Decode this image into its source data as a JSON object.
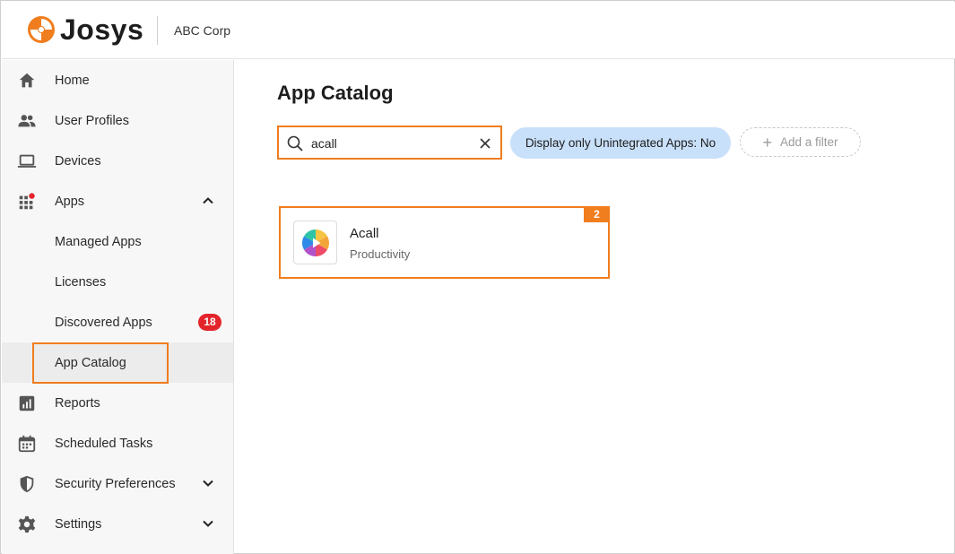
{
  "header": {
    "brand": "Josys",
    "org": "ABC Corp"
  },
  "sidebar": {
    "items": [
      {
        "label": "Home",
        "icon": "home-icon"
      },
      {
        "label": "User Profiles",
        "icon": "users-icon"
      },
      {
        "label": "Devices",
        "icon": "laptop-icon"
      },
      {
        "label": "Apps",
        "icon": "apps-grid-icon",
        "expanded": true
      },
      {
        "label": "Managed Apps"
      },
      {
        "label": "Licenses"
      },
      {
        "label": "Discovered Apps",
        "badge": "18"
      },
      {
        "label": "App Catalog",
        "active": true
      },
      {
        "label": "Reports",
        "icon": "reports-icon"
      },
      {
        "label": "Scheduled Tasks",
        "icon": "calendar-icon"
      },
      {
        "label": "Security Preferences",
        "icon": "shield-icon",
        "expanded": false
      },
      {
        "label": "Settings",
        "icon": "gear-icon",
        "expanded": false
      }
    ]
  },
  "main": {
    "title": "App Catalog",
    "search": {
      "value": "acall",
      "placeholder": ""
    },
    "filter_chip": "Display only Unintegrated Apps: No",
    "add_filter": "Add a filter",
    "results": [
      {
        "name": "Acall",
        "category": "Productivity"
      }
    ],
    "step_badge": "2"
  },
  "colors": {
    "accent": "#f07d1e",
    "badge_red": "#e3242b",
    "chip_blue": "#c9e0fa",
    "sidebar_bg": "#f7f7f7"
  }
}
